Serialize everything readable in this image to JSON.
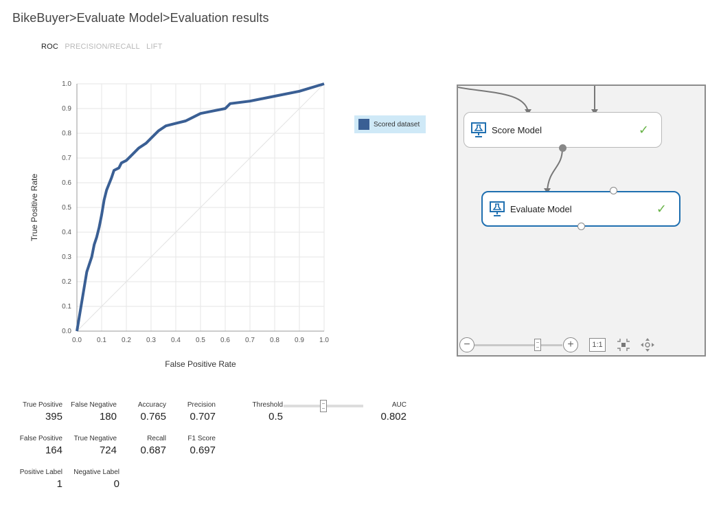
{
  "breadcrumb": {
    "parts": [
      "BikeBuyer",
      "Evaluate Model",
      "Evaluation results"
    ],
    "separator": ">"
  },
  "tabs": [
    {
      "label": "ROC",
      "active": true
    },
    {
      "label": "PRECISION/RECALL",
      "active": false
    },
    {
      "label": "LIFT",
      "active": false
    }
  ],
  "chart_data": {
    "type": "line",
    "title": "",
    "xlabel": "False Positive Rate",
    "ylabel": "True Positive Rate",
    "xlim": [
      0.0,
      1.0
    ],
    "ylim": [
      0.0,
      1.0
    ],
    "x_ticks": [
      "0.0",
      "0.1",
      "0.2",
      "0.3",
      "0.4",
      "0.5",
      "0.6",
      "0.7",
      "0.8",
      "0.9",
      "1.0"
    ],
    "y_ticks": [
      "0.0",
      "0.1",
      "0.2",
      "0.3",
      "0.4",
      "0.5",
      "0.6",
      "0.7",
      "0.8",
      "0.9",
      "1.0"
    ],
    "grid": true,
    "legend_position": "right",
    "series": [
      {
        "name": "Scored dataset",
        "color": "#3a5f94",
        "x": [
          0.0,
          0.01,
          0.02,
          0.03,
          0.04,
          0.05,
          0.06,
          0.07,
          0.08,
          0.09,
          0.1,
          0.11,
          0.12,
          0.14,
          0.15,
          0.17,
          0.18,
          0.2,
          0.22,
          0.25,
          0.28,
          0.3,
          0.33,
          0.36,
          0.4,
          0.44,
          0.46,
          0.5,
          0.55,
          0.6,
          0.62,
          0.7,
          0.8,
          0.9,
          1.0
        ],
        "y": [
          0.0,
          0.06,
          0.12,
          0.18,
          0.24,
          0.27,
          0.3,
          0.35,
          0.38,
          0.42,
          0.47,
          0.53,
          0.57,
          0.62,
          0.65,
          0.66,
          0.68,
          0.69,
          0.71,
          0.74,
          0.76,
          0.78,
          0.81,
          0.83,
          0.84,
          0.85,
          0.86,
          0.88,
          0.89,
          0.9,
          0.92,
          0.93,
          0.95,
          0.97,
          1.0
        ]
      },
      {
        "name": "",
        "color": "#e3e3e3",
        "x": [
          0.0,
          1.0
        ],
        "y": [
          0.0,
          1.0
        ]
      }
    ]
  },
  "legend": {
    "label": "Scored dataset",
    "color": "#3a5f94",
    "background": "#cfe9f7"
  },
  "canvas": {
    "score_node": {
      "label": "Score Model",
      "status": "✓"
    },
    "eval_node": {
      "label": "Evaluate Model",
      "status": "✓"
    },
    "zoom_minus": "−",
    "zoom_plus": "+",
    "one_to_one": "1:1",
    "zoom_level": 0.72
  },
  "metrics": {
    "true_positive": {
      "label": "True Positive",
      "value": "395"
    },
    "false_negative": {
      "label": "False Negative",
      "value": "180"
    },
    "accuracy": {
      "label": "Accuracy",
      "value": "0.765"
    },
    "precision": {
      "label": "Precision",
      "value": "0.707"
    },
    "threshold": {
      "label": "Threshold",
      "value": "0.5"
    },
    "auc": {
      "label": "AUC",
      "value": "0.802"
    },
    "false_positive": {
      "label": "False Positive",
      "value": "164"
    },
    "true_negative": {
      "label": "True Negative",
      "value": "724"
    },
    "recall": {
      "label": "Recall",
      "value": "0.687"
    },
    "f1_score": {
      "label": "F1 Score",
      "value": "0.697"
    },
    "positive_label": {
      "label": "Positive Label",
      "value": "1"
    },
    "negative_label": {
      "label": "Negative Label",
      "value": "0"
    }
  }
}
